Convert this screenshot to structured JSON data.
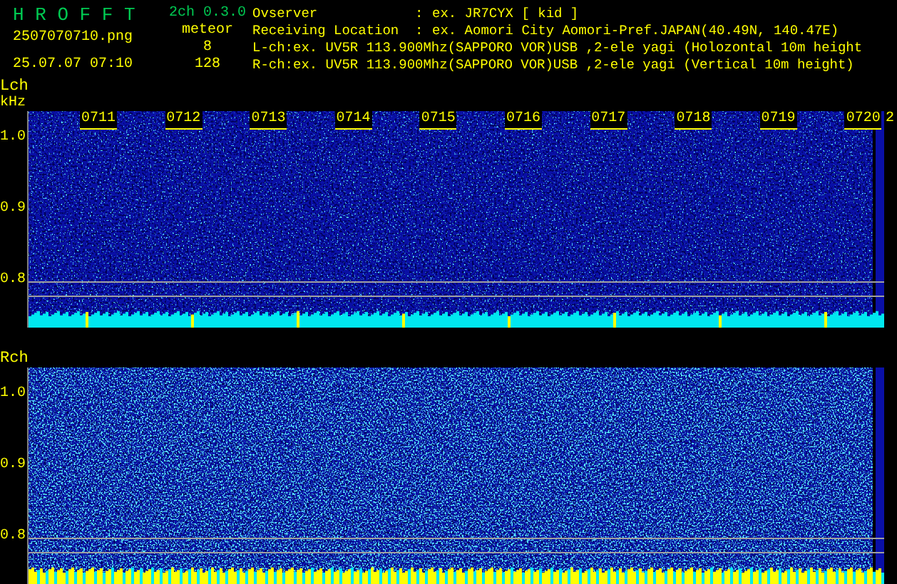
{
  "app": {
    "title": "H R O F F T",
    "version": "2ch 0.3.0",
    "filename": "2507070710.png",
    "datetime": "25.07.07 07:10"
  },
  "counts": {
    "label": "meteor",
    "lch": "8",
    "rch": "128"
  },
  "info": [
    {
      "label": "Ovserver",
      "separator": ":",
      "value": "ex. JR7CYX [ kid ]"
    },
    {
      "label": "Receiving Location",
      "separator": ":",
      "value": "ex. Aomori City Aomori-Pref.JAPAN(40.49N, 140.47E)"
    }
  ],
  "channel_lines": [
    "L-ch:ex. UV5R 113.900Mhz(SAPPORO VOR)USB ,2-ele yagi (Holozontal 10m height",
    "R-ch:ex. UV5R 113.900Mhz(SAPPORO VOR)USB ,2-ele yagi (Vertical 10m height)"
  ],
  "panels": [
    {
      "channel": "Lch",
      "unit": "kHz",
      "time_labels": [
        "0711",
        "0712",
        "0713",
        "0714",
        "0715",
        "0716",
        "0717",
        "0718",
        "0719",
        "0720"
      ],
      "edge_label": "2",
      "yticks": [
        "1.0",
        "0.9",
        "0.8"
      ],
      "kind": "sparse"
    },
    {
      "channel": "Rch",
      "yticks": [
        "1.0",
        "0.9",
        "0.8"
      ],
      "kind": "dense"
    }
  ]
}
